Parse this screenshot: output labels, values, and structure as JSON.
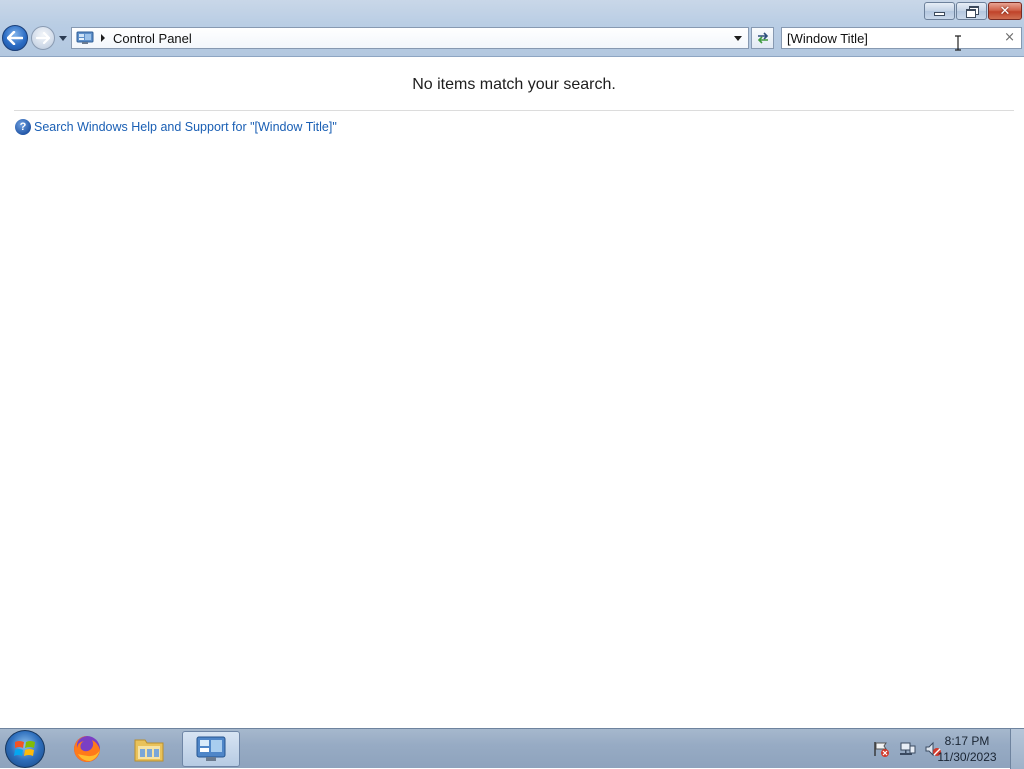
{
  "window": {
    "caption_buttons": [
      "minimize",
      "restore",
      "close"
    ]
  },
  "navigation": {
    "back_icon": "back-arrow-icon",
    "forward_icon": "forward-arrow-icon",
    "recent_pages_icon": "chevron-down-icon"
  },
  "address_bar": {
    "location_icon": "control-panel-icon",
    "path": [
      "Control Panel"
    ],
    "path_0": "Control Panel"
  },
  "search": {
    "value": "[Window Title]",
    "clear_label": "×"
  },
  "content": {
    "message": "No items match your search.",
    "help_link": "Search Windows Help and Support for \"[Window Title]\""
  },
  "taskbar": {
    "pinned": [
      {
        "name": "start",
        "icon": "windows-logo-icon"
      },
      {
        "name": "firefox",
        "icon": "firefox-icon"
      },
      {
        "name": "file-explorer",
        "icon": "folder-icon"
      },
      {
        "name": "control-panel",
        "icon": "control-panel-icon",
        "active": true
      }
    ],
    "tray_icons": [
      "action-center-flag-icon",
      "network-icon",
      "volume-muted-icon"
    ],
    "clock": {
      "time": "8:17 PM",
      "date": "11/30/2023"
    }
  },
  "colors": {
    "link": "#1a5fb4",
    "chrome": "#b9cde4",
    "taskbar": "#97abc4"
  }
}
